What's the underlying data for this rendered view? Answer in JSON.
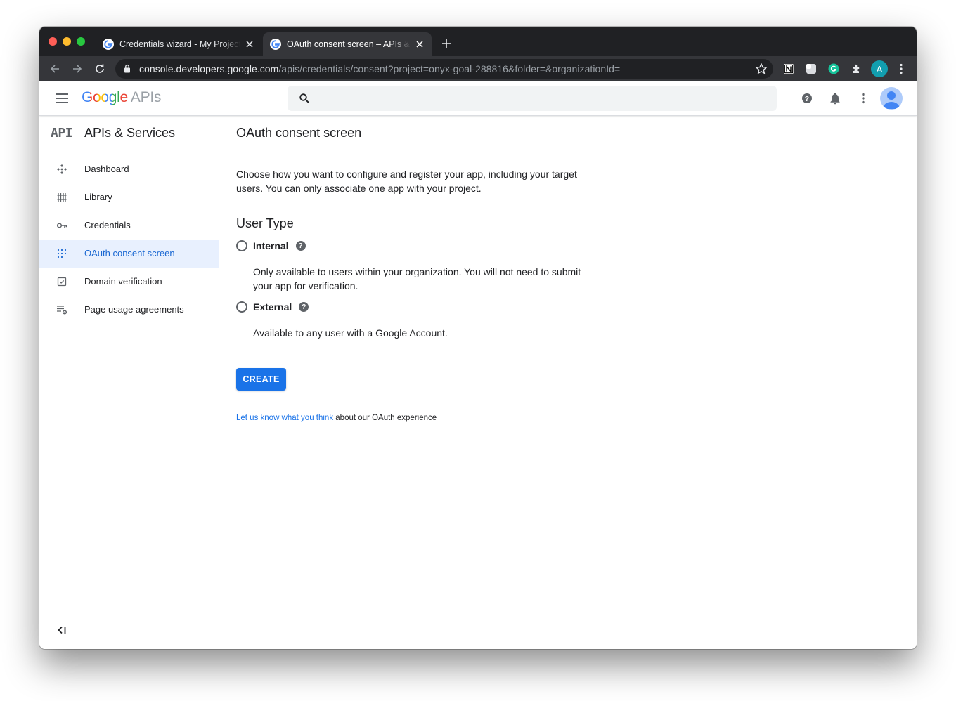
{
  "browser": {
    "tabs": [
      {
        "title": "Credentials wizard - My Project",
        "active": false
      },
      {
        "title": "OAuth consent screen – APIs & Services",
        "active": true
      }
    ],
    "url_host": "console.developers.google.com",
    "url_path": "/apis/credentials/consent?project=onyx-goal-288816&folder=&organizationId=",
    "profile_initial": "A",
    "colors": {
      "frame": "#202124",
      "toolbar": "#35363a",
      "profile": "#129eaf"
    }
  },
  "header": {
    "logo_text": "Google",
    "logo_suffix": "APIs",
    "icons": [
      "menu-icon",
      "search-icon",
      "help-icon",
      "notifications-icon",
      "more-vert-icon",
      "account-avatar"
    ]
  },
  "sidebar": {
    "logo": "API",
    "title": "APIs & Services",
    "items": [
      {
        "label": "Dashboard",
        "icon": "dashboard-icon",
        "active": false
      },
      {
        "label": "Library",
        "icon": "library-icon",
        "active": false
      },
      {
        "label": "Credentials",
        "icon": "key-icon",
        "active": false
      },
      {
        "label": "OAuth consent screen",
        "icon": "consent-icon",
        "active": true
      },
      {
        "label": "Domain verification",
        "icon": "domain-verification-icon",
        "active": false
      },
      {
        "label": "Page usage agreements",
        "icon": "page-settings-icon",
        "active": false
      }
    ],
    "collapse_icon": "collapse-sidebar-icon"
  },
  "main": {
    "title": "OAuth consent screen",
    "intro": "Choose how you want to configure and register your app, including your target users. You can only associate one app with your project.",
    "section_title": "User Type",
    "options": [
      {
        "label": "Internal",
        "description": "Only available to users within your organization. You will not need to submit your app for verification.",
        "selected": false
      },
      {
        "label": "External",
        "description": "Available to any user with a Google Account.",
        "selected": false
      }
    ],
    "create_label": "CREATE",
    "feedback_link": "Let us know what you think",
    "feedback_suffix": " about our OAuth experience",
    "colors": {
      "accent": "#1a73e8",
      "active_bg": "#e8f0fe"
    }
  }
}
